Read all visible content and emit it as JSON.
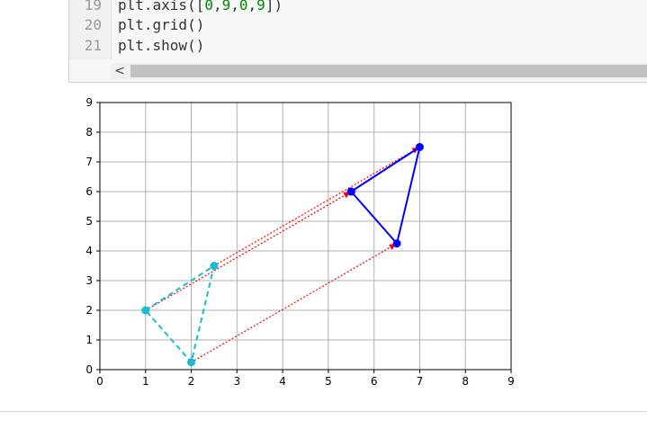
{
  "editor": {
    "lines": [
      {
        "num": "19",
        "parts": [
          {
            "t": "plt.axis(["
          },
          {
            "t": "0",
            "c": "num"
          },
          {
            "t": ","
          },
          {
            "t": "9",
            "c": "num"
          },
          {
            "t": ","
          },
          {
            "t": "0",
            "c": "num"
          },
          {
            "t": ","
          },
          {
            "t": "9",
            "c": "num"
          },
          {
            "t": "])"
          }
        ]
      },
      {
        "num": "20",
        "parts": [
          {
            "t": "plt.grid()"
          }
        ]
      },
      {
        "num": "21",
        "parts": [
          {
            "t": "plt.show()"
          }
        ]
      }
    ],
    "scroll_left_glyph": "<"
  },
  "chart_data": {
    "type": "line",
    "xlim": [
      0,
      9
    ],
    "ylim": [
      0,
      9
    ],
    "x_ticks": [
      0,
      1,
      2,
      3,
      4,
      5,
      6,
      7,
      8,
      9
    ],
    "y_ticks": [
      0,
      1,
      2,
      3,
      4,
      5,
      6,
      7,
      8,
      9
    ],
    "grid": true,
    "series": [
      {
        "style": "dashed-marker",
        "color": "#17becf",
        "x": [
          1,
          2.5,
          2,
          1
        ],
        "y": [
          2,
          3.5,
          0.25,
          2
        ]
      },
      {
        "style": "solid-marker",
        "color": "#0000ff",
        "x": [
          5.5,
          7,
          6.5,
          5.5
        ],
        "y": [
          6,
          7.5,
          4.25,
          6
        ]
      }
    ],
    "arrows": [
      {
        "color": "#ff0000",
        "from": [
          1,
          2
        ],
        "to": [
          5.5,
          6
        ]
      },
      {
        "color": "#ff0000",
        "from": [
          2.5,
          3.5
        ],
        "to": [
          7,
          7.5
        ]
      },
      {
        "color": "#ff0000",
        "from": [
          2,
          0.25
        ],
        "to": [
          6.5,
          4.25
        ]
      }
    ]
  }
}
